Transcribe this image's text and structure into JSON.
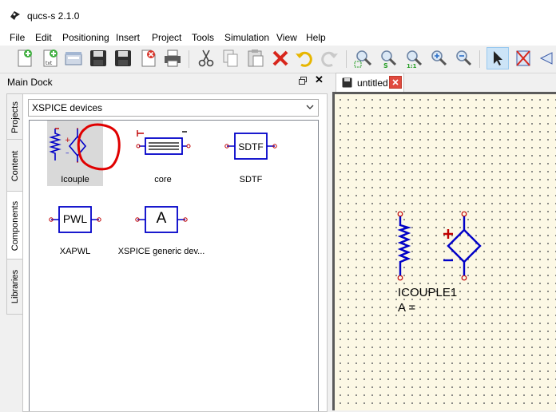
{
  "window": {
    "title": "qucs-s 2.1.0"
  },
  "menu": [
    "File",
    "Edit",
    "Positioning",
    "Insert",
    "Project",
    "Tools",
    "Simulation",
    "View",
    "Help"
  ],
  "toolbar": {
    "icons": [
      "new-document-icon",
      "new-text-icon",
      "open-icon",
      "save-icon",
      "save-all-icon",
      "close-document-icon",
      "print-icon",
      "cut-icon",
      "copy-icon",
      "paste-icon",
      "delete-icon",
      "undo-icon",
      "redo-icon",
      "zoom-fit-icon",
      "zoom-selection-icon",
      "zoom-one-icon",
      "zoom-in-icon",
      "zoom-out-icon",
      "select-icon",
      "deactivate-icon",
      "mirror-icon"
    ]
  },
  "dock": {
    "title": "Main Dock",
    "tabs": [
      "Projects",
      "Content",
      "Components",
      "Libraries"
    ],
    "active_tab": "Components",
    "library_select": "XSPICE devices",
    "components": [
      {
        "label": "Icouple",
        "selected": true
      },
      {
        "label": "core"
      },
      {
        "label": "SDTF",
        "symbol_text": "SDTF"
      },
      {
        "label": "XAPWL",
        "symbol_text": "PWL"
      },
      {
        "label": "XSPICE generic dev...",
        "symbol_text": "A"
      }
    ]
  },
  "document": {
    "tab_label": "untitled",
    "component_name": "ICOUPLE1",
    "component_param": "A ="
  },
  "colors": {
    "schematic_wire": "#0000c8",
    "pin": "#c00000",
    "canvas_bg": "#fcf8e5",
    "annotation": "#e00000"
  }
}
